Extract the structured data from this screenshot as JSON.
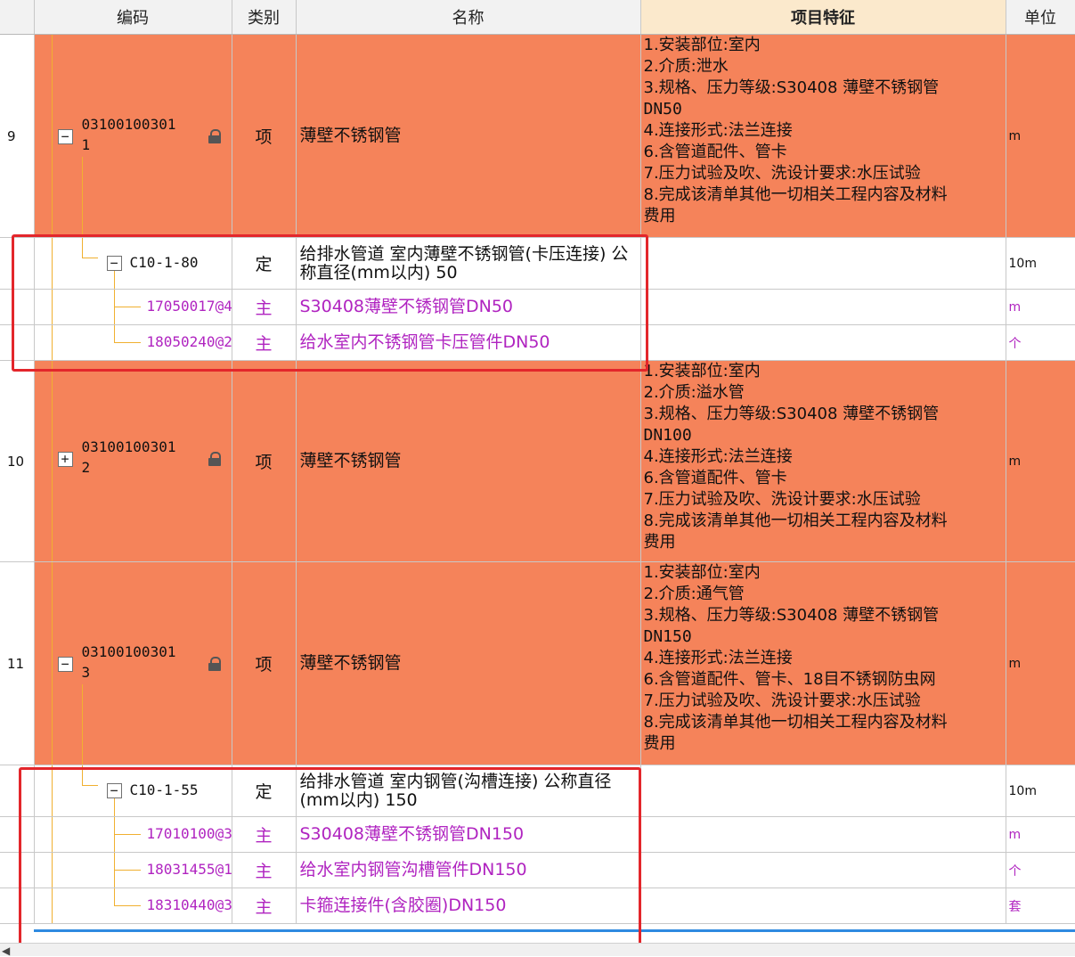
{
  "columns": {
    "num": "",
    "code": "编码",
    "category": "类别",
    "name": "名称",
    "features": "项目特征",
    "unit": "单位"
  },
  "rows": [
    {
      "num": "9",
      "code_line1": "03100100301",
      "code_line2": "1",
      "category": "项",
      "name": "薄壁不锈钢管",
      "unit": "m",
      "toggle": "−",
      "locked": true,
      "features": [
        "1.安装部位:室内",
        "2.介质:泄水",
        "3.规格、压力等级:S30408 薄壁不锈钢管",
        "DN50",
        "4.连接形式:法兰连接",
        "6.含管道配件、管卡",
        "7.压力试验及吹、洗设计要求:水压试验",
        "8.完成该清单其他一切相关工程内容及材料",
        "费用"
      ]
    },
    {
      "code": "C10-1-80",
      "category": "定",
      "name": "给排水管道 室内薄壁不锈钢管(卡压连接) 公称直径(mm以内) 50",
      "unit": "10m",
      "toggle": "−"
    },
    {
      "code": "17050017@4",
      "category": "主",
      "name": "S30408薄壁不锈钢管DN50",
      "unit": "m"
    },
    {
      "code": "18050240@2",
      "category": "主",
      "name": "给水室内不锈钢管卡压管件DN50",
      "unit": "个"
    },
    {
      "num": "10",
      "code_line1": "03100100301",
      "code_line2": "2",
      "category": "项",
      "name": "薄壁不锈钢管",
      "unit": "m",
      "toggle": "+",
      "locked": true,
      "features": [
        "1.安装部位:室内",
        "2.介质:溢水管",
        "3.规格、压力等级:S30408 薄壁不锈钢管",
        "DN100",
        "4.连接形式:法兰连接",
        "6.含管道配件、管卡",
        "7.压力试验及吹、洗设计要求:水压试验",
        "8.完成该清单其他一切相关工程内容及材料",
        "费用"
      ]
    },
    {
      "num": "11",
      "code_line1": "03100100301",
      "code_line2": "3",
      "category": "项",
      "name": "薄壁不锈钢管",
      "unit": "m",
      "toggle": "−",
      "locked": true,
      "features": [
        "1.安装部位:室内",
        "2.介质:通气管",
        "3.规格、压力等级:S30408 薄壁不锈钢管",
        "DN150",
        "4.连接形式:法兰连接",
        "6.含管道配件、管卡、18目不锈钢防虫网",
        "7.压力试验及吹、洗设计要求:水压试验",
        "8.完成该清单其他一切相关工程内容及材料",
        "费用"
      ]
    },
    {
      "code": "C10-1-55",
      "category": "定",
      "name": "给排水管道 室内钢管(沟槽连接) 公称直径(mm以内) 150",
      "unit": "10m",
      "toggle": "−"
    },
    {
      "code": "17010100@3",
      "category": "主",
      "name": "S30408薄壁不锈钢管DN150",
      "unit": "m"
    },
    {
      "code": "18031455@1",
      "category": "主",
      "name": "给水室内钢管沟槽管件DN150",
      "unit": "个"
    },
    {
      "code": "18310440@3",
      "category": "主",
      "name": "卡箍连接件(含胶圈)DN150",
      "unit": "套"
    }
  ],
  "colors": {
    "item_row": "#f5835a",
    "highlight_box": "#e3262b",
    "material_text": "#b024c0",
    "tree_line": "#f0b030",
    "active_header": "#fbe9cc"
  }
}
